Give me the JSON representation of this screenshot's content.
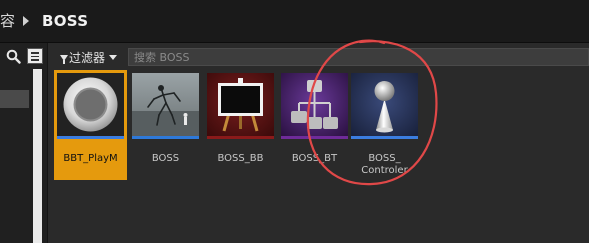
{
  "breadcrumb": {
    "prev": "容",
    "current": "BOSS"
  },
  "toolbar": {
    "filter_label": "过滤器",
    "search_placeholder": "搜索 BOSS"
  },
  "assets": [
    {
      "label": "BBT_PlayM",
      "selected": true,
      "icon": "ring-icon",
      "stripe": "#3b7de0"
    },
    {
      "label": "BOSS",
      "selected": false,
      "icon": "skeletal-mesh-preview",
      "stripe": "#2e79d9"
    },
    {
      "label": "BOSS_BB",
      "selected": false,
      "icon": "blackboard-icon",
      "stripe": "#8a1a1a"
    },
    {
      "label": "BOSS_BT",
      "selected": false,
      "icon": "behavior-tree-icon",
      "stripe": "#6f2b9a"
    },
    {
      "label": "BOSS_\nControler",
      "selected": false,
      "icon": "pawn-icon",
      "stripe": "#3b7de0"
    }
  ],
  "colors": {
    "selection": "#e59a0d",
    "annotation": "#e04848"
  }
}
